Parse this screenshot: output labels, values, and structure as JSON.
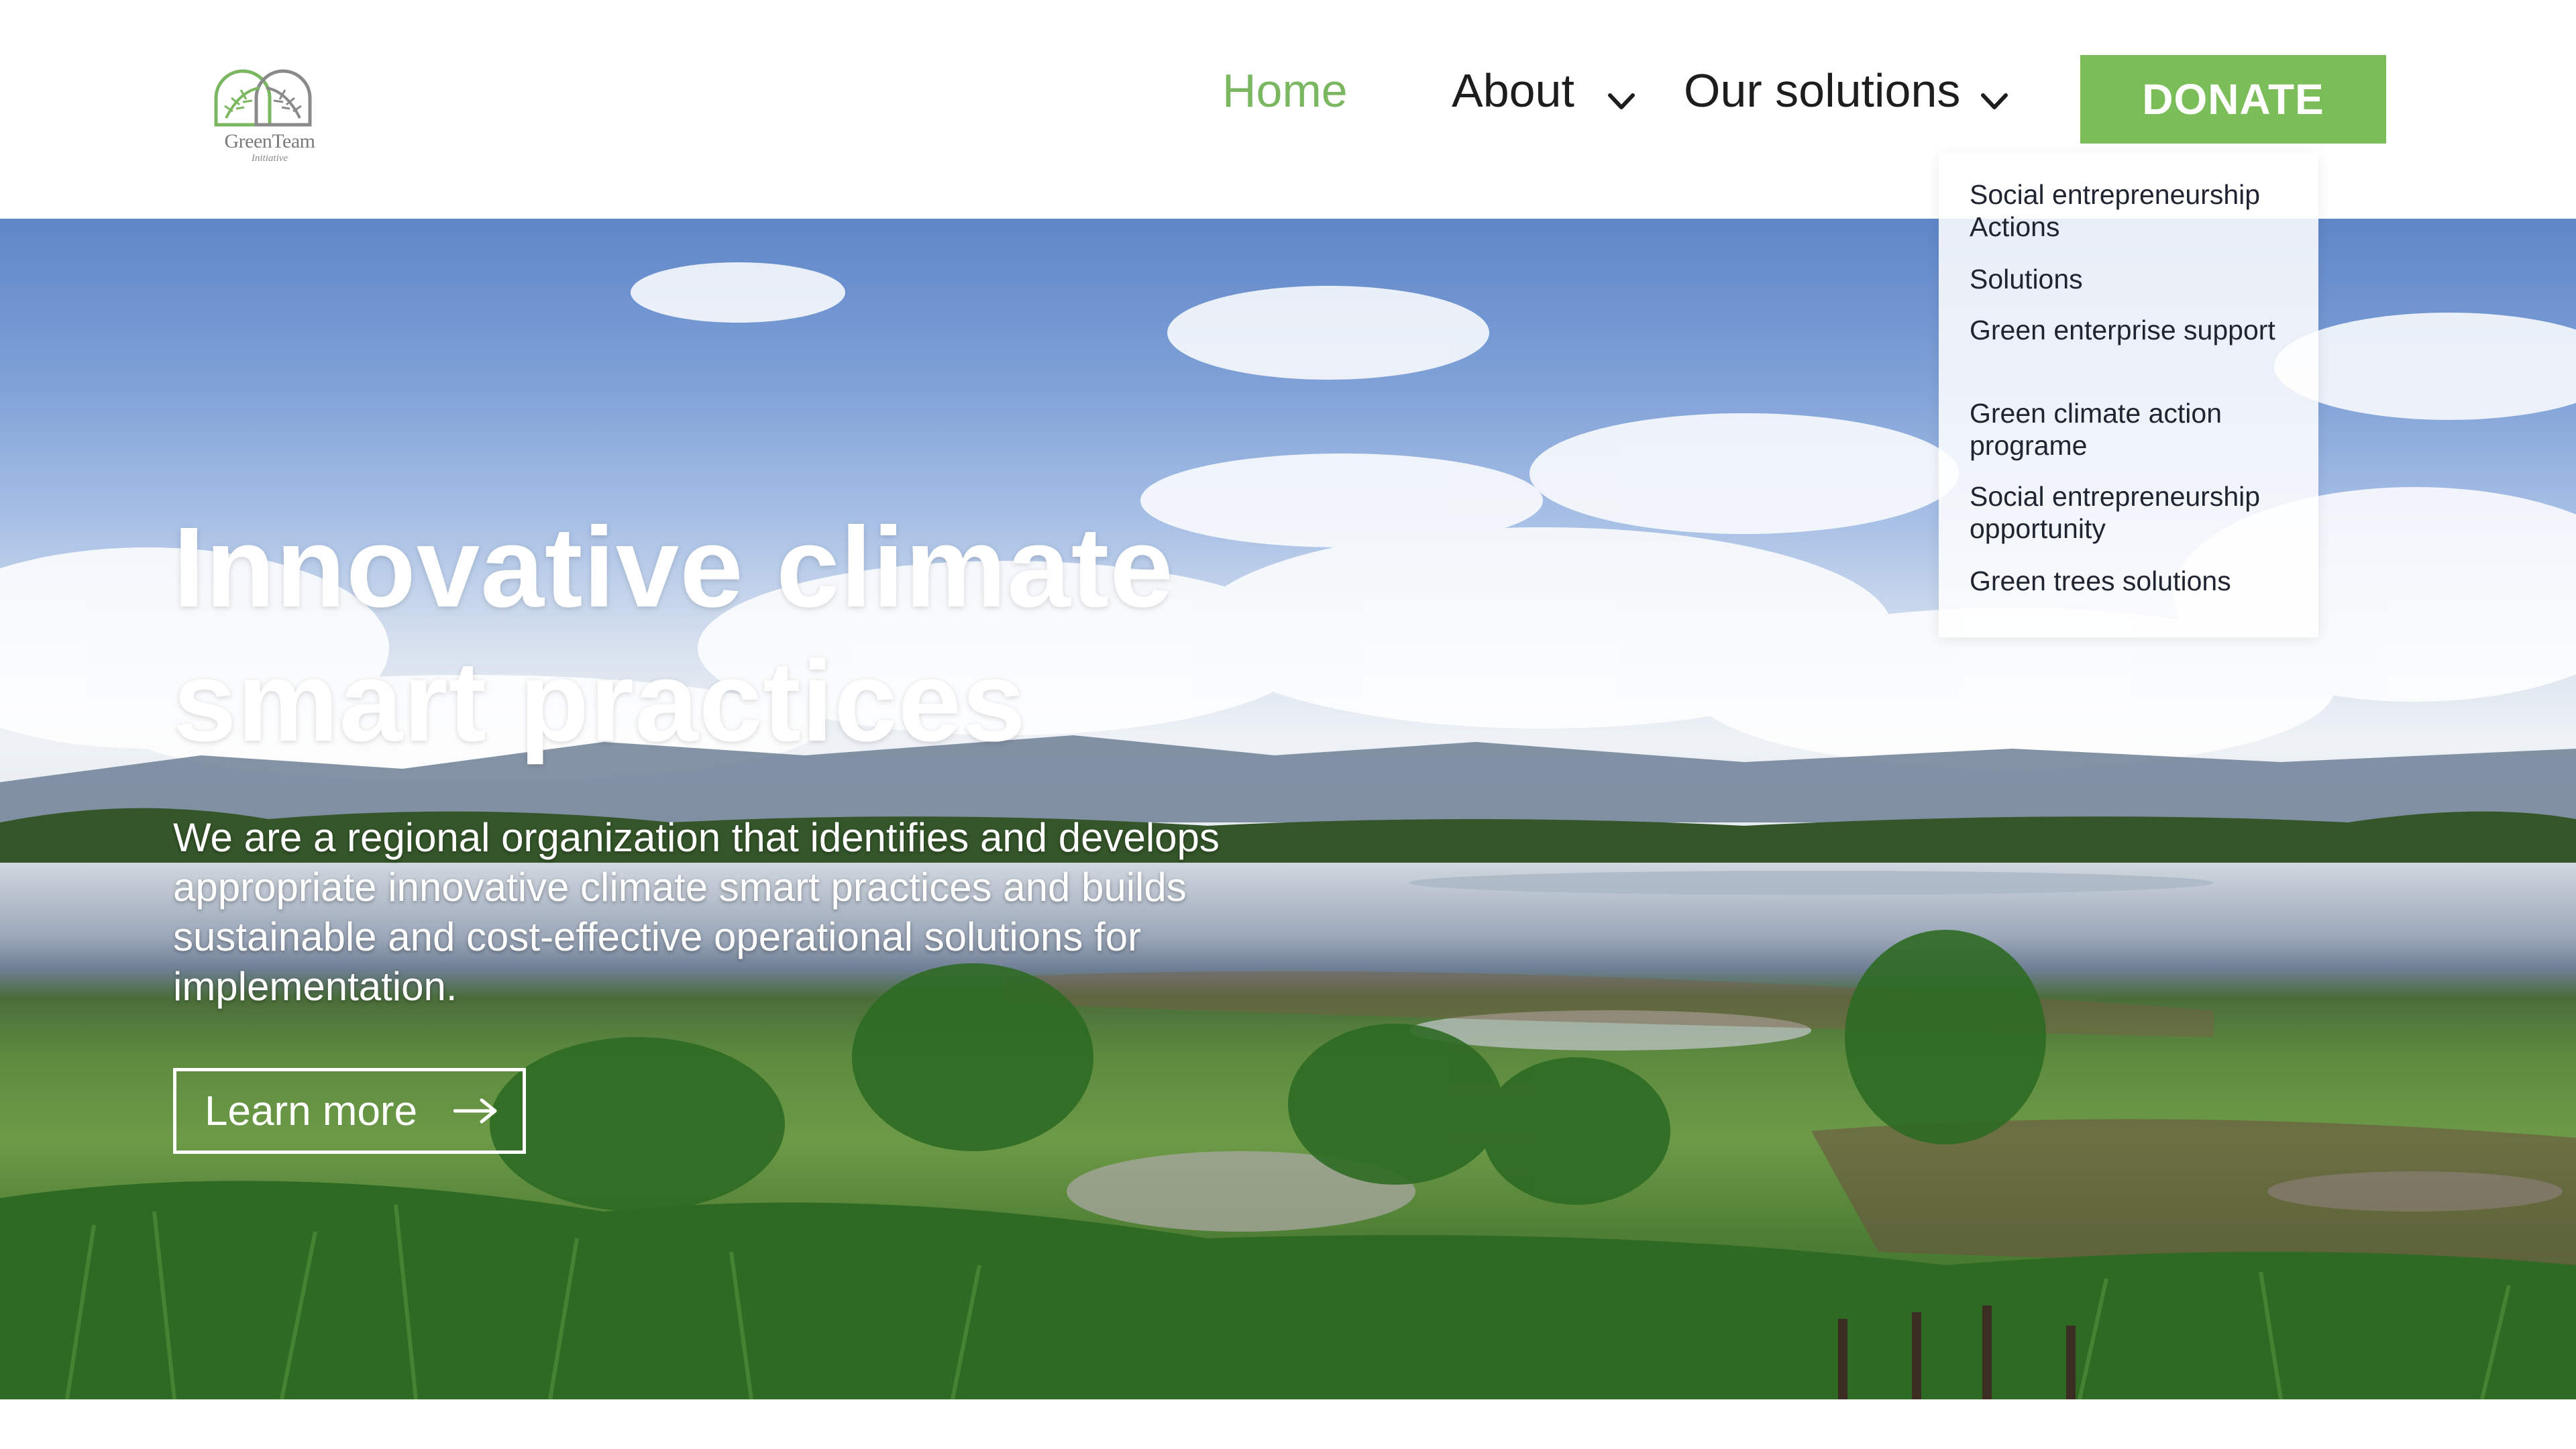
{
  "header": {
    "logo": {
      "line1": "GreenTeam",
      "line2": "Initiative"
    },
    "nav": [
      {
        "label": "Home",
        "active": true
      },
      {
        "label": "About",
        "has_dropdown": true
      },
      {
        "label": "Our solutions",
        "has_dropdown": true
      }
    ],
    "donate_label": "DONATE"
  },
  "dropdown": {
    "items": [
      {
        "label": "Social entrepreneurship Actions"
      },
      {
        "label": "Solutions"
      },
      {
        "label": "Green enterprise support"
      },
      {
        "label": "Green climate action programe"
      },
      {
        "label": "Social entrepreneurship opportunity"
      },
      {
        "label": "Green trees solutions"
      }
    ]
  },
  "hero": {
    "title_line1": "Innovative climate",
    "title_line2": "smart practices",
    "description": "We are a regional organization that identifies and develops appropriate innovative climate smart practices and builds sustainable and cost-effective operational solutions for implementation.",
    "cta_label": "Learn more"
  },
  "colors": {
    "accent": "#7bb661",
    "donate_bg": "#7bbd58",
    "text_dark": "#1d1d1d",
    "white": "#ffffff"
  },
  "icons": {
    "logo": "leaf-logo-icon",
    "dropdown": "chevron-down-icon",
    "cta": "arrow-right-icon"
  }
}
